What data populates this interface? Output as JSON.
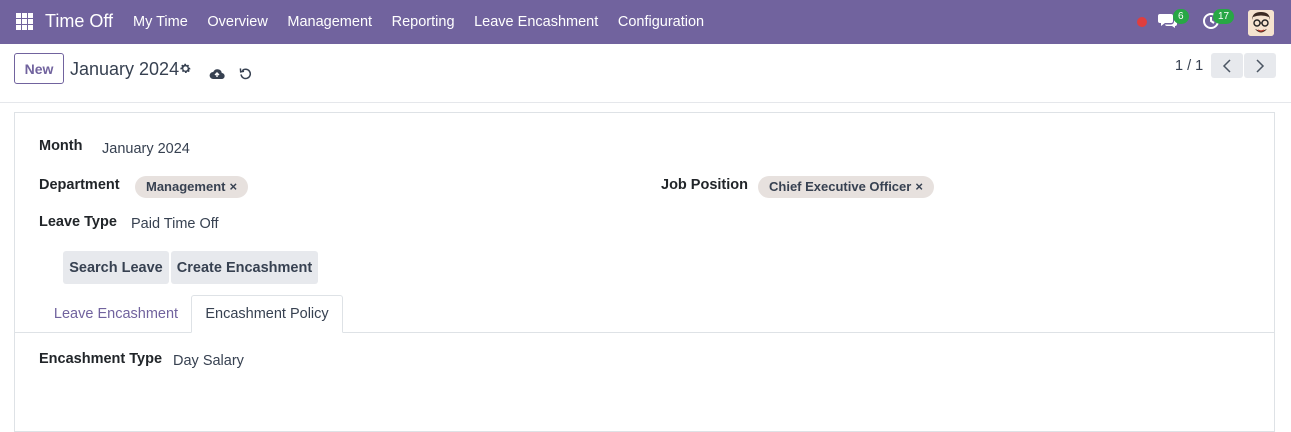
{
  "navbar": {
    "app_name": "Time Off",
    "menu": [
      "My Time",
      "Overview",
      "Management",
      "Reporting",
      "Leave Encashment",
      "Configuration"
    ],
    "chat_badge": "6",
    "activity_badge": "17",
    "colors": {
      "bar": "#71639e",
      "badge": "#28a745",
      "recording": "#e03e3e"
    }
  },
  "control_panel": {
    "new_label": "New",
    "record_title": "January 2024",
    "pager": "1 / 1"
  },
  "form": {
    "month_label": "Month",
    "month_value": "January 2024",
    "department_label": "Department",
    "department_tag": "Management",
    "job_position_label": "Job Position",
    "job_position_tag": "Chief Executive Officer",
    "leave_type_label": "Leave Type",
    "leave_type_value": "Paid Time Off",
    "search_leave_label": "Search Leave",
    "create_encashment_label": "Create Encashment",
    "tabs": [
      "Leave Encashment",
      "Encashment Policy"
    ],
    "active_tab": "Encashment Policy",
    "encashment_type_label": "Encashment Type",
    "encashment_type_value": "Day Salary"
  },
  "tag_remove_symbol": "×",
  "icons": [
    "apps-grid-icon",
    "chat-icon",
    "clock-icon",
    "gear-icon",
    "cloud-upload-icon",
    "undo-icon",
    "chevron-left-icon",
    "chevron-right-icon"
  ]
}
